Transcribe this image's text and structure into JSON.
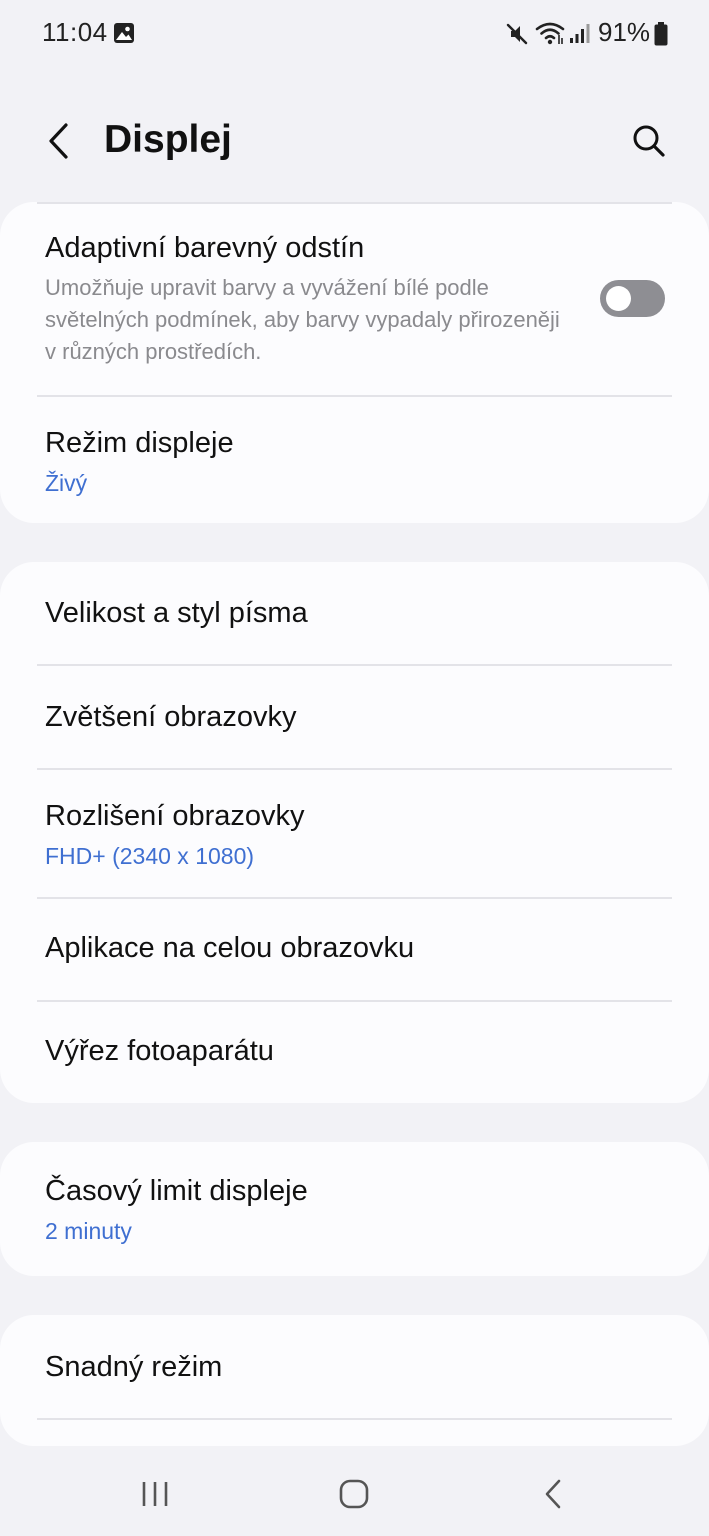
{
  "status_bar": {
    "time": "11:04",
    "battery": "91%",
    "icons": [
      "gallery-icon",
      "mute-icon",
      "wifi-icon",
      "signal-icon",
      "battery-icon"
    ]
  },
  "header": {
    "title": "Displej",
    "back_icon": "back-arrow-icon",
    "search_icon": "search-icon"
  },
  "group1": {
    "adaptive": {
      "title": "Adaptivní barevný odstín",
      "description": "Umožňuje upravit barvy a vyvážení bílé podle světelných podmínek, aby barvy vypadaly přirozeněji v různých prostředích.",
      "toggle_on": false
    },
    "display_mode": {
      "title": "Režim displeje",
      "value": "Živý"
    }
  },
  "group2": {
    "font": {
      "title": "Velikost a styl písma"
    },
    "zoom": {
      "title": "Zvětšení obrazovky"
    },
    "resolution": {
      "title": "Rozlišení obrazovky",
      "value": "FHD+ (2340 x 1080)"
    },
    "fullscreen_apps": {
      "title": "Aplikace na celou obrazovku"
    },
    "camera_cutout": {
      "title": "Výřez fotoaparátu"
    }
  },
  "group3": {
    "timeout": {
      "title": "Časový limit displeje",
      "value": "2 minuty"
    }
  },
  "group4": {
    "easy_mode": {
      "title": "Snadný režim"
    }
  },
  "nav": {
    "icons": [
      "recent-apps-icon",
      "home-icon",
      "back-icon"
    ]
  },
  "colors": {
    "background": "#f2f2f6",
    "card": "#fcfcfe",
    "accent": "#3f6fd1",
    "description": "#8a8a8e",
    "toggle_off": "#8e8e93"
  }
}
